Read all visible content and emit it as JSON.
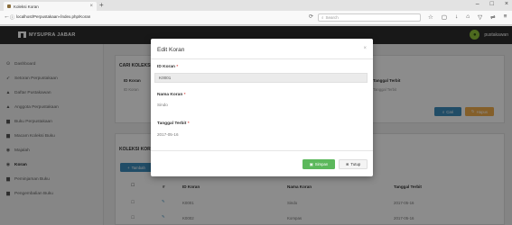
{
  "browser": {
    "tab_title": "Koleksi Koran",
    "tab_close": "×",
    "new_tab": "+",
    "url": "localhost/Perpustakaan-/index.php/Koran",
    "reload": "⟳",
    "search_placeholder": "Search",
    "window_controls": [
      "–",
      "□",
      "×"
    ]
  },
  "header": {
    "brand": "MYSUPRA JABAR",
    "username": "pustakawan"
  },
  "sidebar": {
    "items": [
      {
        "icon": "⊙",
        "label": "Dashboard",
        "active": false
      },
      {
        "icon": "➶",
        "label": "Setoran Perpustakaan",
        "active": false
      },
      {
        "icon": "▲",
        "label": "Daftar Pustakawan",
        "active": false
      },
      {
        "icon": "▲",
        "label": "Anggota Perpustakaan",
        "active": false
      },
      {
        "icon": "▆",
        "label": "Buku Perpustakaan",
        "active": false
      },
      {
        "icon": "▆",
        "label": "Macam Koleksi Buku",
        "active": false
      },
      {
        "icon": "◉",
        "label": "Majalah",
        "active": false
      },
      {
        "icon": "◉",
        "label": "Koran",
        "active": true
      },
      {
        "icon": "▆",
        "label": "Peminjaman Buku",
        "active": false
      },
      {
        "icon": "▆",
        "label": "Pengembalian Buku",
        "active": false
      }
    ]
  },
  "search_panel": {
    "title": "CARI KOLEKSI",
    "label_id": "ID Koran",
    "sub_id": "ID Koran",
    "label_tanggal": "Tanggal Terbit",
    "sub_tanggal": "Tanggal Terbit",
    "cari": "Cari",
    "hapus": "Hapus"
  },
  "collection": {
    "title": "KOLEKSI KORAN",
    "tambah": "Tambah",
    "columns": [
      "#",
      "ID Koran",
      "Nama Koran",
      "Tanggal Terbit"
    ],
    "rows": [
      {
        "id": "K0001",
        "nama": "Sindo",
        "tanggal": "2017-05-16"
      },
      {
        "id": "K0002",
        "nama": "Kompas",
        "tanggal": "2017-05-16"
      }
    ]
  },
  "modal": {
    "title": "Edit Koran",
    "close": "×",
    "field_id_label": "ID Koran",
    "field_id_value": "K0001",
    "field_nama_label": "Nama Koran",
    "field_nama_value": "Sindo",
    "field_tanggal_label": "Tanggal Terbit",
    "field_tanggal_value": "2017-05-16",
    "required_mark": "*",
    "save": "Simpan",
    "close_btn": "Tutup"
  },
  "colors": {
    "primary": "#3c8dbc",
    "success": "#5cb85c",
    "warning": "#f0ad4e",
    "header_bg": "#2d2d2d"
  }
}
